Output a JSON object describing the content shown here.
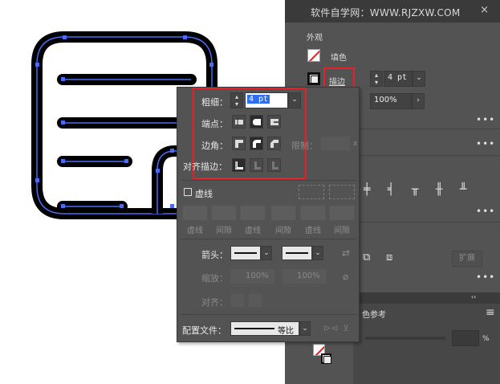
{
  "canvas": {
    "art_icon": "document-stroke-artwork"
  },
  "panel": {
    "watermark": "软件自学网：WWW.RJZXW.COM",
    "close_glyph": "×",
    "section_appearance": "外观",
    "fill_label": "填色",
    "stroke_label": "描边",
    "stroke_weight_value": "4 pt",
    "opacity_value": "100%",
    "more_glyph": "•••",
    "expand_button": "扩展",
    "color_ref_tab": "色参考",
    "percent_sign": "%",
    "collapse_glyph": "‹‹",
    "menu_glyph": "≡",
    "accent_color": "#e8202a"
  },
  "popup": {
    "weight_label": "粗细：",
    "weight_value": "4 pt",
    "cap_label": "端点：",
    "corner_label": "边角：",
    "limit_label": "限制：",
    "limit_unit": "x",
    "align_label": "对齐描边：",
    "dashed_label": "虚线",
    "dash_headers": [
      "虚线",
      "间隙",
      "虚线",
      "间隙",
      "虚线",
      "间隙"
    ],
    "arrow_label": "箭头：",
    "scale_label": "缩放：",
    "scale_value1": "100%",
    "scale_value2": "100%",
    "align2_label": "对齐：",
    "profile_label": "配置文件：",
    "profile_value": "等比"
  }
}
